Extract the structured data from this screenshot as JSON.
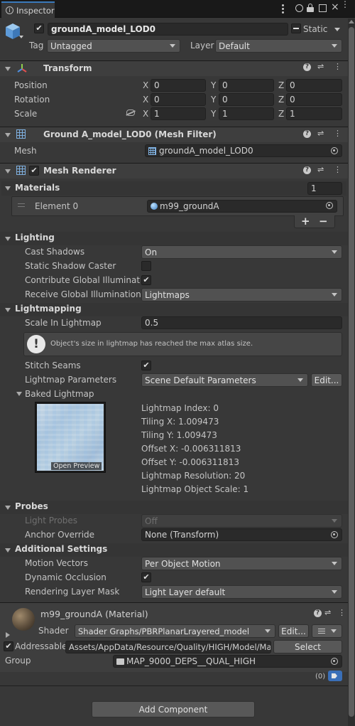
{
  "window": {
    "tab_title": "Inspector"
  },
  "object": {
    "name": "groundA_model_LOD0",
    "static_label": "Static",
    "tag_label": "Tag",
    "tag_value": "Untagged",
    "layer_label": "Layer",
    "layer_value": "Default"
  },
  "transform": {
    "title": "Transform",
    "position_label": "Position",
    "rotation_label": "Rotation",
    "scale_label": "Scale",
    "position": {
      "x": "0",
      "y": "0",
      "z": "0"
    },
    "rotation": {
      "x": "0",
      "y": "0",
      "z": "0"
    },
    "scale": {
      "x": "1",
      "y": "1",
      "z": "1"
    }
  },
  "axes": {
    "x": "X",
    "y": "Y",
    "z": "Z"
  },
  "mesh_filter": {
    "title": "Ground A_model_LOD0 (Mesh Filter)",
    "mesh_label": "Mesh",
    "mesh_value": "groundA_model_LOD0"
  },
  "mesh_renderer": {
    "title": "Mesh Renderer",
    "materials_label": "Materials",
    "materials_count": "1",
    "element_label": "Element 0",
    "element_value": "m99_groundA",
    "add_btn": "+",
    "remove_btn": "−"
  },
  "lighting": {
    "title": "Lighting",
    "cast_shadows_label": "Cast Shadows",
    "cast_shadows_value": "On",
    "static_shadow_label": "Static Shadow Caster",
    "contribute_gi_label": "Contribute Global Illumination",
    "receive_gi_label": "Receive Global Illumination",
    "receive_gi_value": "Lightmaps"
  },
  "lightmapping": {
    "title": "Lightmapping",
    "scale_label": "Scale In Lightmap",
    "scale_value": "0.5",
    "warning": "Object's size in lightmap has reached the max atlas size.",
    "stitch_label": "Stitch Seams",
    "params_label": "Lightmap Parameters",
    "params_value": "Scene Default Parameters",
    "edit_btn": "Edit...",
    "baked_label": "Baked Lightmap",
    "open_preview": "Open Preview",
    "info": [
      "Lightmap Index: 0",
      "Tiling X: 1.009473",
      "Tiling Y: 1.009473",
      "Offset X: -0.006311813",
      "Offset Y: -0.006311813",
      "Lightmap Resolution: 20",
      "Lightmap Object Scale: 1"
    ]
  },
  "probes": {
    "title": "Probes",
    "light_probes_label": "Light Probes",
    "light_probes_value": "Off",
    "anchor_label": "Anchor Override",
    "anchor_value": "None (Transform)"
  },
  "additional": {
    "title": "Additional Settings",
    "motion_label": "Motion Vectors",
    "motion_value": "Per Object Motion",
    "occlusion_label": "Dynamic Occlusion",
    "layer_mask_label": "Rendering Layer Mask",
    "layer_mask_value": "Light Layer default"
  },
  "material": {
    "title": "m99_groundA (Material)",
    "shader_label": "Shader",
    "shader_value": "Shader Graphs/PBRPlanarLrayered_model",
    "edit_btn": "Edit...",
    "addressable_label": "Addressable",
    "address_value": "Assets/AppData/Resource/Quality/HIGH/Model/Ma",
    "select_btn": "Select",
    "group_label": "Group",
    "group_value": "MAP_9000_DEPS__QUAL_HIGH",
    "label_count": "(0)"
  },
  "footer": {
    "add_component": "Add Component"
  },
  "colors": {
    "accent": "#3a79bb",
    "panel": "#383838",
    "field": "#2a2a2a",
    "button": "#585858"
  }
}
